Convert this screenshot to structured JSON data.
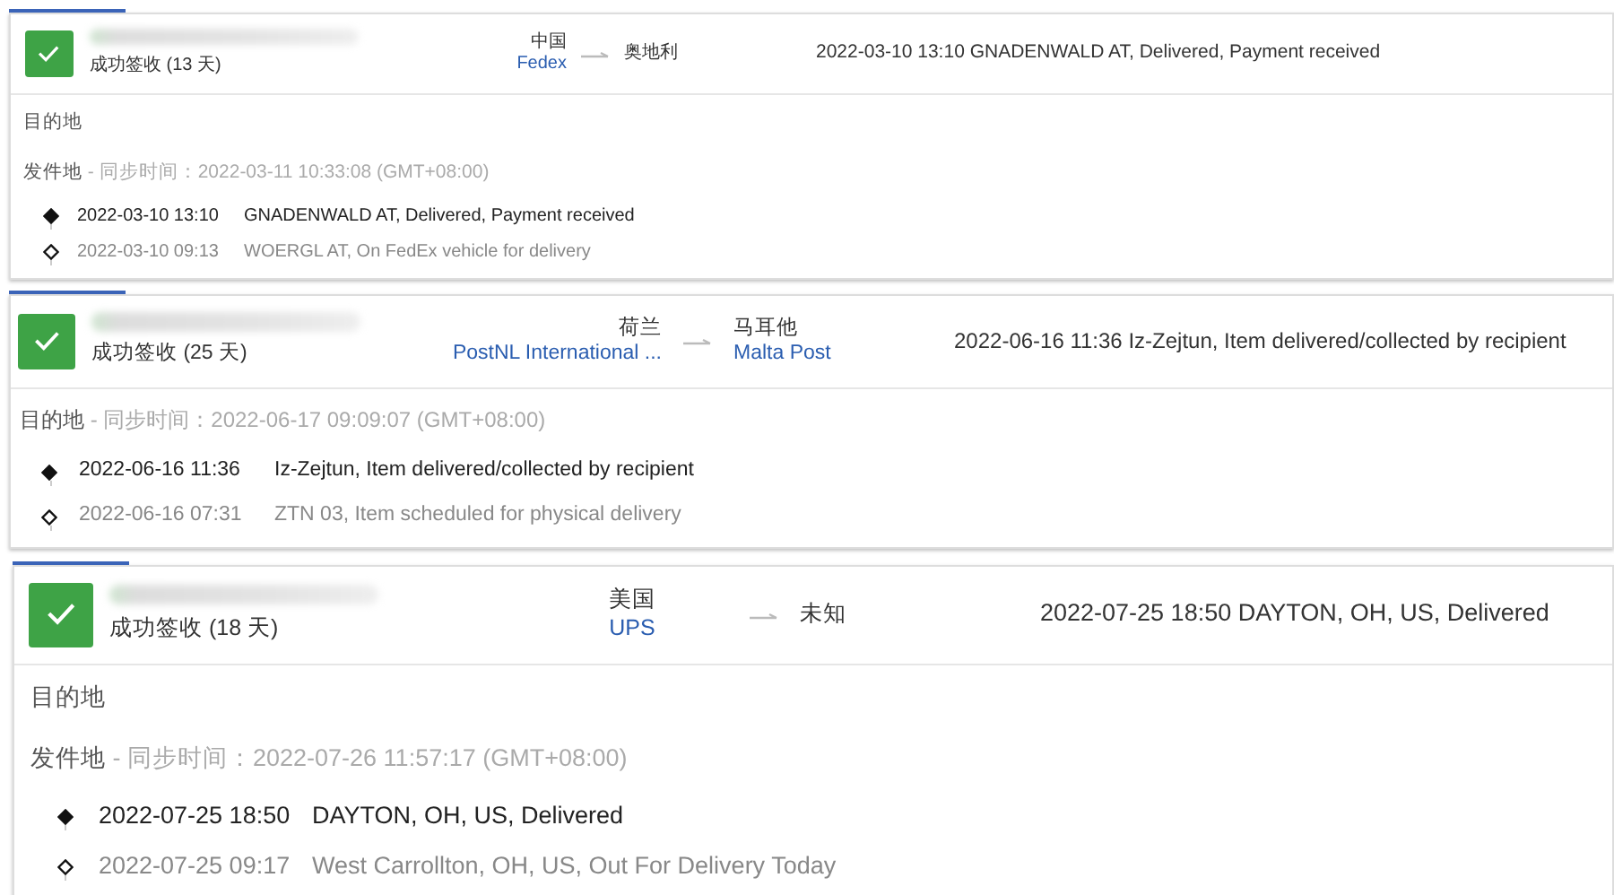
{
  "shipments": [
    {
      "status": "成功签收 (13 天)",
      "delivered": true,
      "origin": {
        "country": "中国",
        "carrier": "Fedex"
      },
      "destination": {
        "country": "奥地利"
      },
      "latest": "2022-03-10 13:10  GNADENWALD AT, Delivered, Payment received",
      "sections": [
        {
          "label": "目的地"
        },
        {
          "label": "发件地",
          "sync": " - 同步时间：2022-03-11 10:33:08 (GMT+08:00)"
        }
      ],
      "events": [
        {
          "time": "2022-03-10 13:10",
          "text": "GNADENWALD AT, Delivered, Payment received",
          "current": true
        },
        {
          "time": "2022-03-10 09:13",
          "text": "WOERGL AT, On FedEx vehicle for delivery",
          "current": false
        }
      ]
    },
    {
      "status": "成功签收 (25 天)",
      "delivered": true,
      "origin": {
        "country": "荷兰",
        "carrier": "PostNL International ..."
      },
      "destination": {
        "country": "马耳他",
        "carrier": "Malta Post"
      },
      "latest": "2022-06-16 11:36  Iz-Zejtun, Item delivered/collected by recipient",
      "sections": [
        {
          "label": "目的地",
          "sync": " - 同步时间：2022-06-17 09:09:07 (GMT+08:00)"
        }
      ],
      "events": [
        {
          "time": "2022-06-16 11:36",
          "text": "Iz-Zejtun, Item delivered/collected by recipient",
          "current": true
        },
        {
          "time": "2022-06-16 07:31",
          "text": "ZTN 03, Item scheduled for physical delivery",
          "current": false
        }
      ]
    },
    {
      "status": "成功签收 (18 天)",
      "delivered": true,
      "origin": {
        "country": "美国",
        "carrier": "UPS"
      },
      "destination": {
        "country": "未知"
      },
      "latest": "2022-07-25 18:50  DAYTON, OH, US, Delivered",
      "sections": [
        {
          "label": "目的地"
        },
        {
          "label": "发件地",
          "sync": " - 同步时间：2022-07-26 11:57:17 (GMT+08:00)"
        }
      ],
      "events": [
        {
          "time": "2022-07-25 18:50",
          "text": "DAYTON, OH, US, Delivered",
          "current": true
        },
        {
          "time": "2022-07-25 09:17",
          "text": "West Carrollton, OH, US, Out For Delivery Today",
          "current": false
        }
      ]
    }
  ]
}
